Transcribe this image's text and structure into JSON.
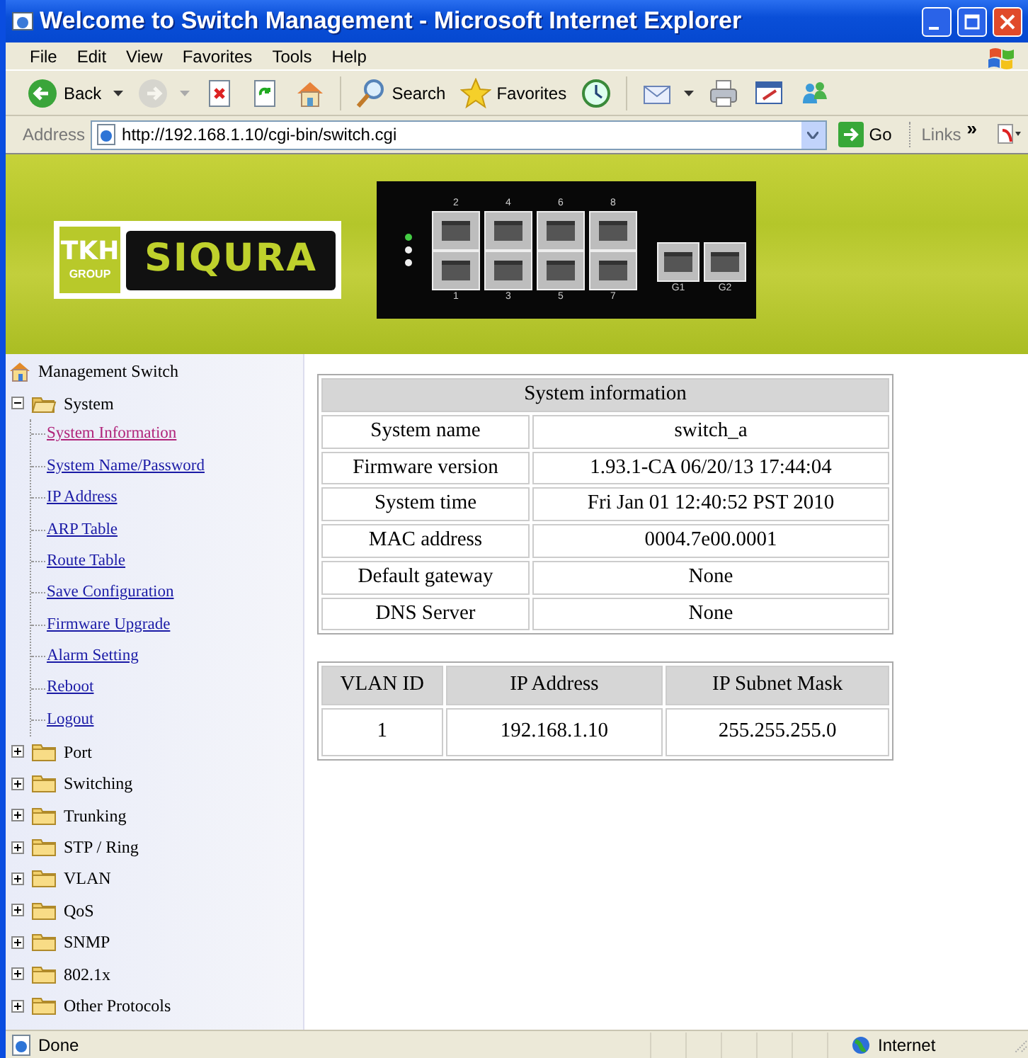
{
  "window": {
    "title": "Welcome to Switch Management - Microsoft Internet Explorer"
  },
  "menu": [
    "File",
    "Edit",
    "View",
    "Favorites",
    "Tools",
    "Help"
  ],
  "toolbar": [
    {
      "kind": "back",
      "label": "Back",
      "disabled": false,
      "dropdown": true
    },
    {
      "kind": "forward",
      "disabled": true,
      "dropdown": true
    },
    {
      "kind": "stop",
      "disabled": false,
      "dropdown": false
    },
    {
      "kind": "refresh",
      "disabled": false,
      "dropdown": false
    },
    {
      "kind": "home",
      "disabled": false,
      "dropdown": false
    },
    {
      "kind": "search",
      "label": "Search",
      "disabled": false,
      "dropdown": false
    },
    {
      "kind": "favorites",
      "label": "Favorites",
      "disabled": false,
      "dropdown": false
    },
    {
      "kind": "history",
      "disabled": false,
      "dropdown": false
    },
    {
      "kind": "mail",
      "disabled": false,
      "dropdown": true
    },
    {
      "kind": "print",
      "disabled": false,
      "dropdown": false
    },
    {
      "kind": "edit",
      "disabled": false,
      "dropdown": false
    },
    {
      "kind": "messenger",
      "disabled": false,
      "dropdown": false
    }
  ],
  "address": {
    "label": "Address",
    "url": "http://192.168.1.10/cgi-bin/switch.cgi",
    "go": "Go",
    "links": "Links",
    "chevron": "»"
  },
  "banner": {
    "logo": {
      "mark": "TKH",
      "group": "GROUP",
      "brand": "SIQURA"
    },
    "switch": {
      "top_ports": [
        "2",
        "4",
        "6",
        "8"
      ],
      "bottom_ports": [
        "1",
        "3",
        "5",
        "7"
      ],
      "uplinks": [
        "G1",
        "G2"
      ]
    }
  },
  "tree": {
    "label": "Management Switch",
    "children": [
      {
        "label": "System",
        "expanded": true,
        "children": [
          {
            "label": "System Information",
            "selected": true
          },
          {
            "label": "System Name/Password",
            "selected": false
          },
          {
            "label": "IP Address",
            "selected": false
          },
          {
            "label": "ARP Table",
            "selected": false
          },
          {
            "label": "Route Table",
            "selected": false
          },
          {
            "label": "Save Configuration",
            "selected": false
          },
          {
            "label": "Firmware Upgrade",
            "selected": false
          },
          {
            "label": "Alarm Setting",
            "selected": false
          },
          {
            "label": "Reboot",
            "selected": false
          },
          {
            "label": "Logout",
            "selected": false
          }
        ]
      },
      {
        "label": "Port",
        "expanded": false
      },
      {
        "label": "Switching",
        "expanded": false
      },
      {
        "label": "Trunking",
        "expanded": false
      },
      {
        "label": "STP / Ring",
        "expanded": false
      },
      {
        "label": "VLAN",
        "expanded": false
      },
      {
        "label": "QoS",
        "expanded": false
      },
      {
        "label": "SNMP",
        "expanded": false
      },
      {
        "label": "802.1x",
        "expanded": false
      },
      {
        "label": "Other Protocols",
        "expanded": false
      }
    ]
  },
  "system_info": {
    "title": "System information",
    "rows": [
      {
        "label": "System name",
        "value": "switch_a"
      },
      {
        "label": "Firmware version",
        "value": "1.93.1-CA 06/20/13 17:44:04"
      },
      {
        "label": "System time",
        "value": "Fri Jan 01 12:40:52 PST 2010"
      },
      {
        "label": "MAC address",
        "value": "0004.7e00.0001"
      },
      {
        "label": "Default gateway",
        "value": "None"
      },
      {
        "label": "DNS Server",
        "value": "None"
      }
    ]
  },
  "vlan_table": {
    "columns": [
      "VLAN ID",
      "IP Address",
      "IP Subnet Mask"
    ],
    "rows": [
      [
        "1",
        "192.168.1.10",
        "255.255.255.0"
      ]
    ]
  },
  "status_bar": {
    "text": "Done",
    "zone": "Internet"
  }
}
